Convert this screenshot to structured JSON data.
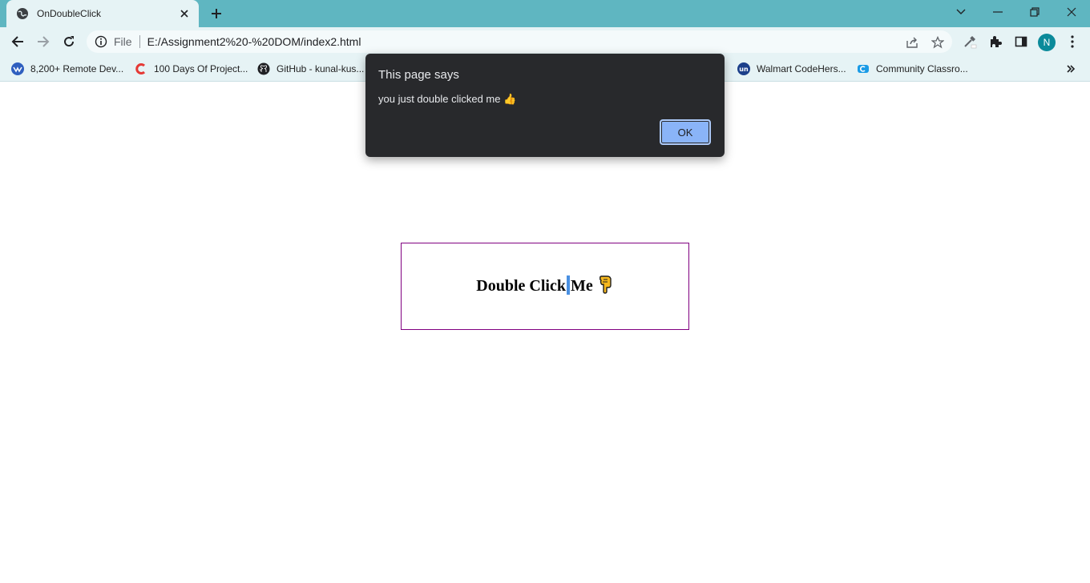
{
  "tab": {
    "title": "OnDoubleClick"
  },
  "omnibox": {
    "scheme_label": "File",
    "url": "E:/Assignment2%20-%20DOM/index2.html"
  },
  "profile": {
    "initial": "N"
  },
  "bookmarks": [
    {
      "label": "8,200+ Remote Dev...",
      "icon": "remote-dev-icon"
    },
    {
      "label": "100 Days Of Project...",
      "icon": "c-logo-icon"
    },
    {
      "label": "GitHub - kunal-kus...",
      "icon": "github-icon"
    },
    {
      "label": "Walmart CodeHers...",
      "icon": "unstop-icon"
    },
    {
      "label": "Community Classro...",
      "icon": "classroom-icon"
    }
  ],
  "page": {
    "box_text_before": "Double Click",
    "box_text_after": "Me"
  },
  "dialog": {
    "title": "This page says",
    "message": "you just double clicked me 👍",
    "ok_label": "OK"
  },
  "colors": {
    "tabstrip": "#5fb6c1",
    "toolbar": "#e6f3f5",
    "box_border": "#800080",
    "dialog_bg": "#28292c",
    "ok_button": "#8ab4f8"
  }
}
